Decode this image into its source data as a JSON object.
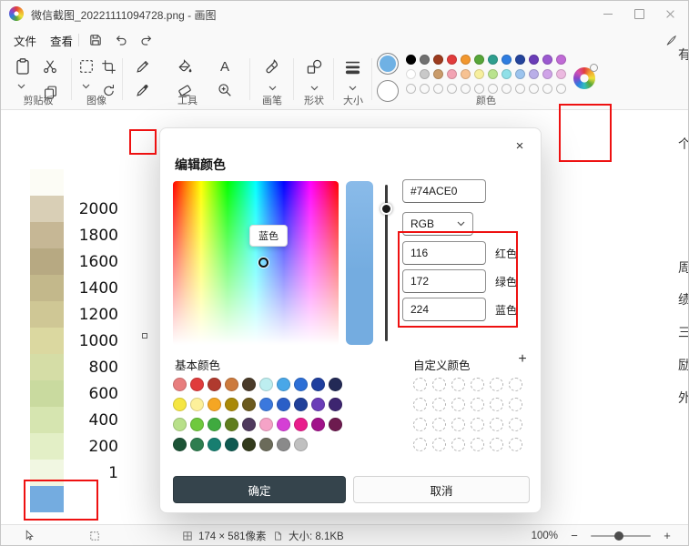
{
  "window": {
    "title": "微信截图_20221111094728.png - 画图"
  },
  "menu": {
    "file": "文件",
    "view": "查看"
  },
  "ribbon": {
    "groups": {
      "clipboard": "剪贴板",
      "image": "图像",
      "tools": "工具",
      "brushes": "画笔",
      "shapes": "形状",
      "size": "大小",
      "colors": "颜色"
    },
    "tools": {
      "text_glyph": "A"
    },
    "palette": {
      "color1": "#6FB1E4",
      "color2": "#FFFFFF",
      "row1": [
        "#000000",
        "#707070",
        "#9C3B1E",
        "#E13C3C",
        "#F2972E",
        "#57A639",
        "#2E9E8E",
        "#2F7DE0",
        "#24449C",
        "#6A3DB8",
        "#9B59D0",
        "#C06BD6"
      ],
      "row2": [
        "#FFFFFF",
        "#C9C9C9",
        "#C99B6A",
        "#F2A3B3",
        "#F7C292",
        "#F7EF9E",
        "#B9E38D",
        "#8FE0E8",
        "#9CC4EE",
        "#B9AEE8",
        "#CFA3E8",
        "#ECB9E0"
      ],
      "empty_slots": 12
    }
  },
  "canvas": {
    "legend_bands": [
      {
        "color": "#FCFCF5",
        "label": ""
      },
      {
        "color": "#D9CFB6",
        "label": "2000"
      },
      {
        "color": "#C6B795",
        "label": "1800"
      },
      {
        "color": "#B7A982",
        "label": "1600"
      },
      {
        "color": "#C3B88B",
        "label": "1400"
      },
      {
        "color": "#CFC795",
        "label": "1200"
      },
      {
        "color": "#DBD8A0",
        "label": "1000"
      },
      {
        "color": "#D5DDA6",
        "label": "800"
      },
      {
        "color": "#C9DA9F",
        "label": "600"
      },
      {
        "color": "#D6E5B0",
        "label": "400"
      },
      {
        "color": "#E3EFC6",
        "label": "200"
      },
      {
        "color": "#F1F7E2",
        "label": "1"
      },
      {
        "color": "#74ACE0",
        "label": ""
      }
    ],
    "edge_text": [
      "有",
      "个",
      "周",
      "绩",
      "三",
      "励",
      "外"
    ]
  },
  "dialog": {
    "title": "编辑颜色",
    "close_glyph": "×",
    "tooltip": "蓝色",
    "hex_value": "#74ACE0",
    "mode_label": "RGB",
    "accent": "#74ACE0",
    "channels": [
      {
        "label": "红色",
        "value": "116"
      },
      {
        "label": "绿色",
        "value": "172"
      },
      {
        "label": "蓝色",
        "value": "224"
      }
    ],
    "basic_colors_label": "基本颜色",
    "custom_colors_label": "自定义颜色",
    "add_custom_glyph": "+",
    "basic_colors": [
      [
        "#E87E7E",
        "#E03C3C",
        "#B03A2E",
        "#CC7A3D",
        "#4A3B2A",
        "#BDEEF0",
        "#49A7E8",
        "#2D6FD6",
        "#1F3E9E",
        "#232A56"
      ],
      [
        "#F5E642",
        "#FDF09A",
        "#F5A623",
        "#A98908",
        "#6B5A1E",
        "#3B78DD",
        "#2B5FC7",
        "#20409A",
        "#6A3DB8",
        "#3D2570"
      ],
      [
        "#B8E08A",
        "#6FC93D",
        "#3FAA3F",
        "#5F7D1E",
        "#4F3A5E",
        "#F5A3C7",
        "#D53FD5",
        "#E91E8C",
        "#A1128A",
        "#6D1B4F"
      ],
      [
        "#1D5437",
        "#2E7D4F",
        "#177E70",
        "#0F5951",
        "#333B1C",
        "#6B6B5A",
        "#8A8A8A",
        "#C0C0C0"
      ]
    ],
    "custom_grid": {
      "rows": 4,
      "cols": 6
    },
    "ok_label": "确定",
    "cancel_label": "取消"
  },
  "statusbar": {
    "selection_size": "174 × 581像素",
    "file_size": "大小: 8.1KB",
    "zoom_level": "100%",
    "zoom_out_glyph": "−",
    "zoom_in_glyph": "+"
  },
  "annotations": {
    "color": "#EE1111"
  }
}
